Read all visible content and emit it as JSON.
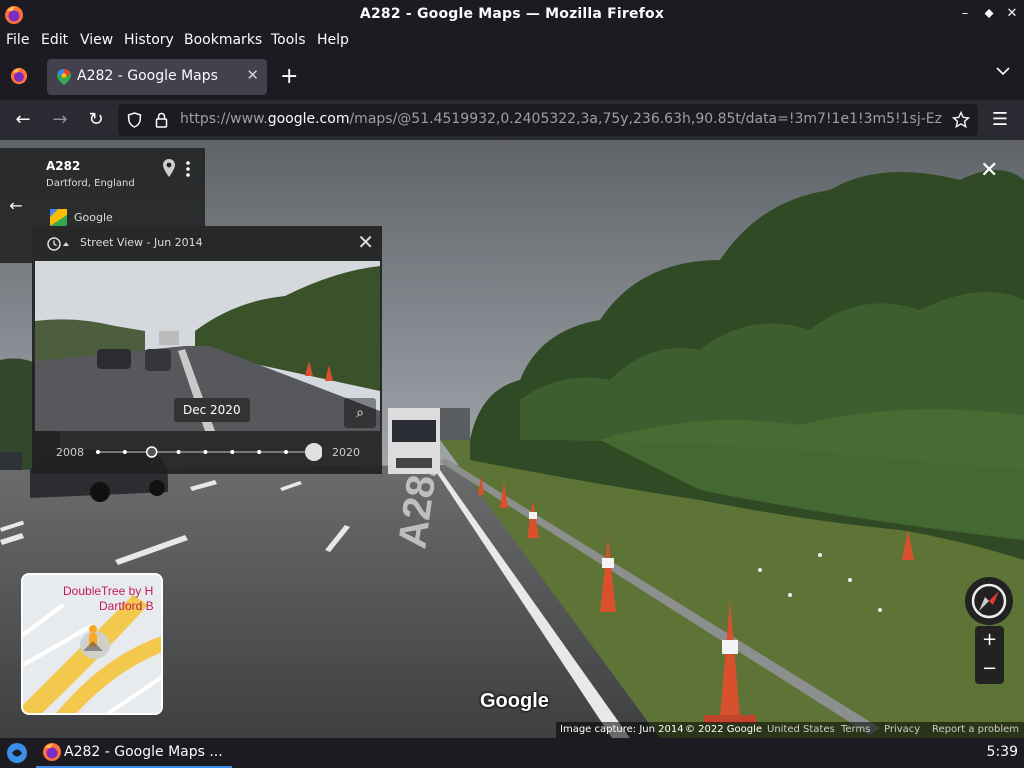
{
  "window": {
    "title": "A282 - Google Maps — Mozilla Firefox",
    "min_glyph": "–",
    "max_glyph": "⬥",
    "close_glyph": "✕"
  },
  "menu": [
    "File",
    "Edit",
    "View",
    "History",
    "Bookmarks",
    "Tools",
    "Help"
  ],
  "tab": {
    "label": "A282 - Google Maps",
    "close_glyph": "✕"
  },
  "newtab_glyph": "+",
  "tabs_dropdown_glyph": "⌵",
  "nav": {
    "back_glyph": "←",
    "forward_glyph": "→",
    "reload_glyph": "↻",
    "menu_glyph": "☰",
    "url_prefix": "https://www.",
    "url_domain": "google.com",
    "url_rest": "/maps/@51.4519932,0.2405322,3a,75y,236.63h,90.85t/data=!3m7!1e1!3m5!1sj-Ez"
  },
  "place": {
    "name": "A282",
    "location": "Dartford, England",
    "provider": "Google"
  },
  "back_glyph": "←",
  "close_view_glyph": "✕",
  "timeline": {
    "header": "Street View - Jun 2014",
    "close_glyph": "✕",
    "tooltip": "Dec 2020",
    "start_year": "2008",
    "end_year": "2020",
    "point_count": 9,
    "selected_point": 8,
    "hover_point": 3,
    "zoom_glyph": "⌕"
  },
  "minimap": {
    "labels": [
      "DoubleTree by H",
      "Dartford B"
    ]
  },
  "road_marking": "A282",
  "watermark": "Google",
  "zoom": {
    "in": "+",
    "out": "−"
  },
  "footer": {
    "capture": "Image capture: Jun 2014",
    "copyright": "© 2022 Google",
    "region": "United States",
    "terms": "Terms",
    "privacy": "Privacy",
    "report": "Report a problem"
  },
  "taskbar": {
    "task_label": "A282 - Google Maps ...",
    "clock": "5:39"
  },
  "colors": {
    "chrome": "#1c1b22",
    "navbar": "#2b2a33",
    "tab": "#42414d",
    "accent": "#3d8ee8",
    "panel": "#222222"
  }
}
